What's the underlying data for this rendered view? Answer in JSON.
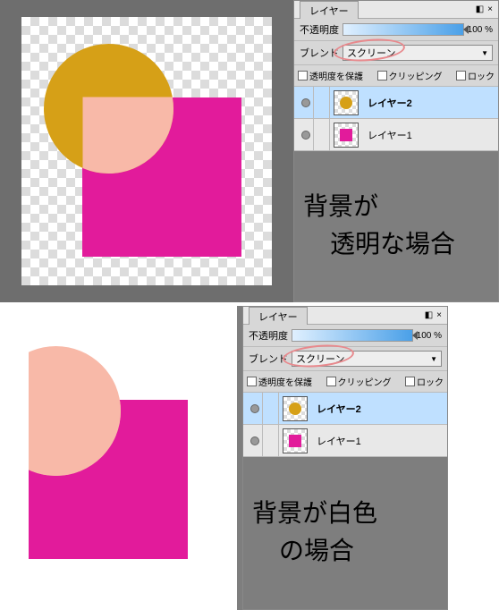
{
  "panel": {
    "title": "レイヤー",
    "dock_icon": "◧",
    "close_icon": "×",
    "opacity_label": "不透明度",
    "opacity_value": "100 %",
    "blend_label": "ブレンド",
    "blend_value": "スクリーン",
    "check_protect": "透明度を保護",
    "check_clip": "クリッピング",
    "check_lock": "ロック",
    "layers": [
      {
        "name": "レイヤー2",
        "color": "#d6a017",
        "shape": "circle",
        "selected": true
      },
      {
        "name": "レイヤー1",
        "color": "#e21b9b",
        "shape": "square",
        "selected": false
      }
    ]
  },
  "notes": {
    "top_line1": "背景が",
    "top_line2": "透明な場合",
    "bottom_line1": "背景が白色",
    "bottom_line2": "の場合"
  },
  "shapes": {
    "square_color": "#e21b9b",
    "circle_color": "#d6a017",
    "circle_screen_on_square": "#f8b9a8"
  }
}
